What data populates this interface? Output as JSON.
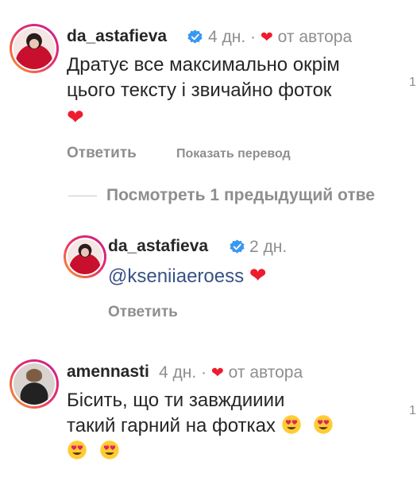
{
  "comment1": {
    "username": "da_astafieva",
    "time": "4 дн.",
    "separator": "·",
    "author_badge": "от автора",
    "text_line1": "Дратує все максимально окрім",
    "text_line2": "цього тексту і звичайно фоток",
    "like_count": "1",
    "reply_label": "Ответить",
    "translate_label": "Показать перевод"
  },
  "view_previous": "Посмотреть 1 предыдущий отве",
  "reply1": {
    "username": "da_astafieva",
    "time": "2 дн.",
    "mention": "@kseniiaeroess",
    "reply_label": "Ответить"
  },
  "comment2": {
    "username": "amennasti",
    "time": "4 дн.",
    "separator": "·",
    "author_badge": "от автора",
    "text_line1": "Бісить, що ти  завждииии",
    "text_line2": "такий гарний на фотках",
    "like_count": "1"
  },
  "colors": {
    "heart": "#ed1c2e",
    "verified": "#3897f0",
    "mention": "#385185",
    "secondary": "#8e8e8e"
  }
}
